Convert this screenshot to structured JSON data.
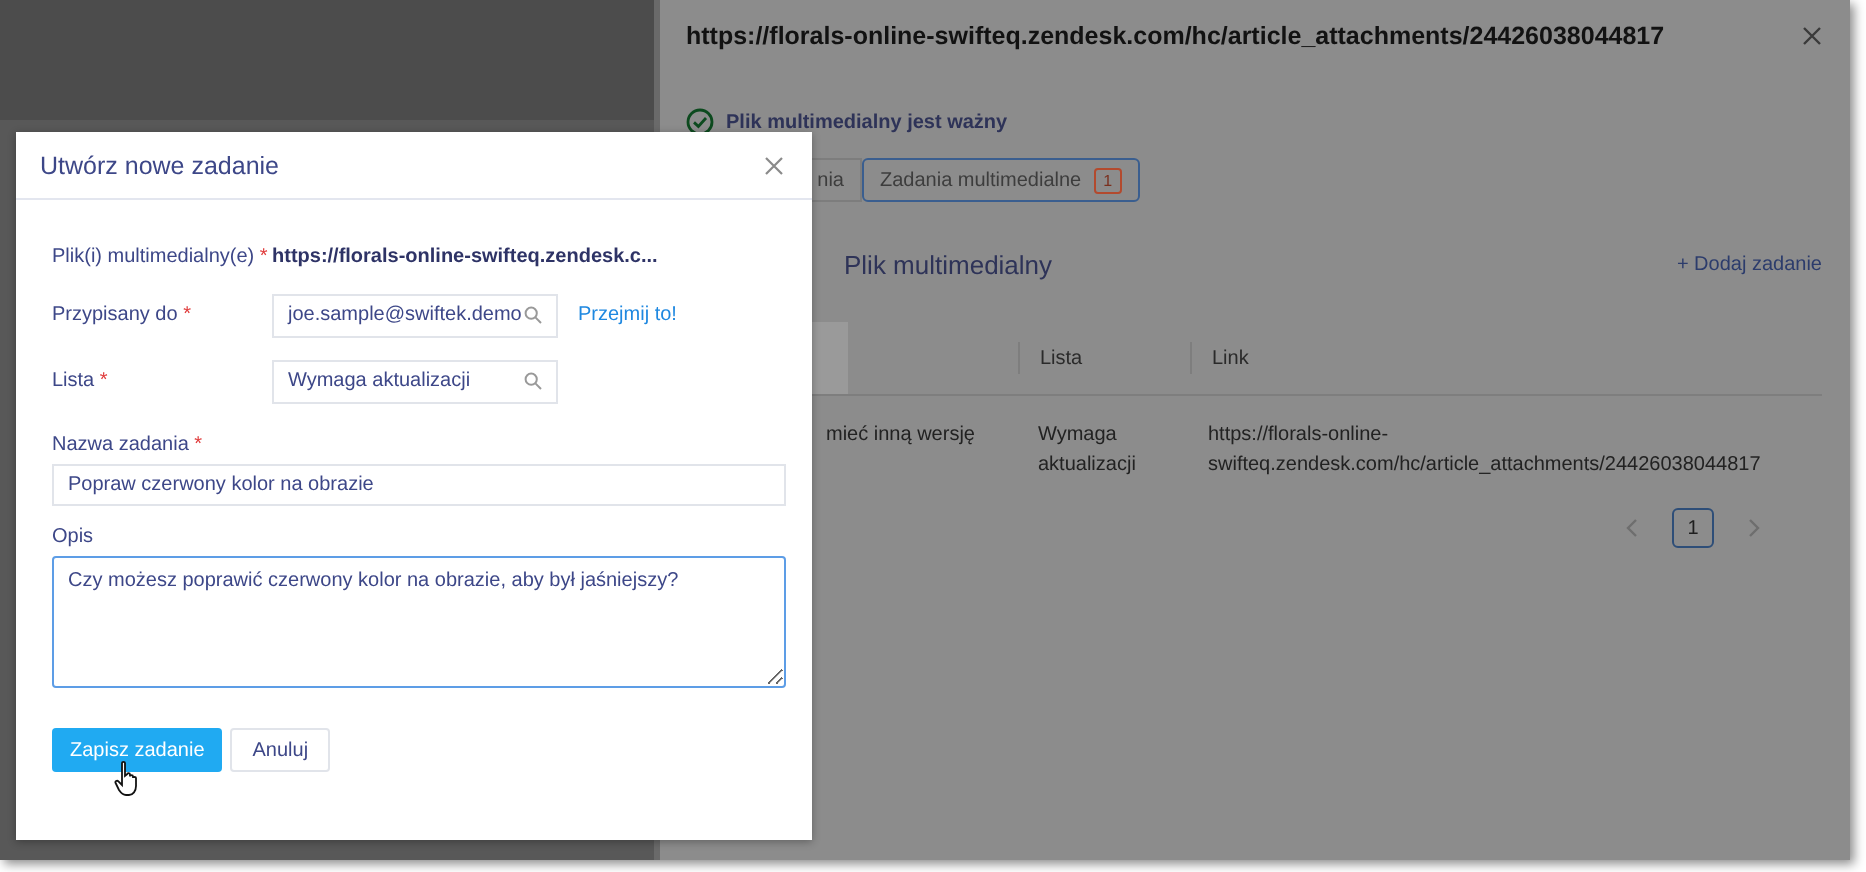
{
  "drawer": {
    "title": "https://florals-online-swifteq.zendesk.com/hc/article_attachments/24426038044817",
    "status": "Plik multimedialny jest ważny",
    "tabs": [
      {
        "label": "nia",
        "selected": false
      },
      {
        "label": "Zadania multimedialne",
        "badge": "1",
        "selected": true
      }
    ],
    "section_title": "Plik multimedialny",
    "add_link": "+ Dodaj zadanie",
    "table": {
      "columns": [
        "Lista",
        "Link"
      ],
      "rows": [
        {
          "column_1": "mieć inną wersję",
          "list": "Wymaga aktualizacji",
          "link": "https://florals-online-swifteq.zendesk.com/hc/article_attachments/24426038044817"
        }
      ]
    },
    "pagination": {
      "pages": [
        {
          "label": "1",
          "selected": true
        }
      ]
    }
  },
  "modal": {
    "title": "Utwórz nowe zadanie",
    "media_label": "Plik(i) multimedialny(e)",
    "media_value": "https://florals-online-swifteq.zendesk.c...",
    "assignee_label": "Przypisany do",
    "assignee_value": "joe.sample@swiftek.demo",
    "take_link": "Przejmij to!",
    "list_label": "Lista",
    "list_value": "Wymaga aktualizacji",
    "name_label": "Nazwa zadania",
    "name_value": "Popraw czerwony kolor na obrazie",
    "desc_label": "Opis",
    "desc_value": "Czy możesz poprawić czerwony kolor na obrazie, aby był jaśniejszy?",
    "required_marks": [
      "*",
      "*",
      "*",
      "*"
    ],
    "save": "Zapisz zadanie",
    "cancel": "Anuluj"
  }
}
